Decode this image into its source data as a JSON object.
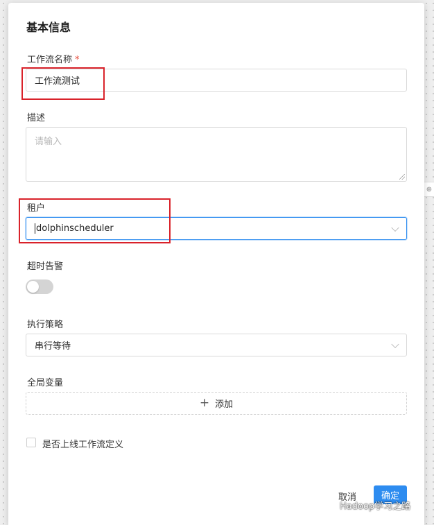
{
  "dialog": {
    "title": "基本信息",
    "fields": {
      "workflow_name": {
        "label": "工作流名称",
        "required_mark": "*",
        "value": "工作流测试"
      },
      "description": {
        "label": "描述",
        "placeholder": "请输入"
      },
      "tenant": {
        "label": "租户",
        "value": "dolphinscheduler"
      },
      "timeout_alarm": {
        "label": "超时告警",
        "enabled": false
      },
      "execution_policy": {
        "label": "执行策略",
        "value": "串行等待"
      },
      "global_variables": {
        "label": "全局变量",
        "add_label": "添加"
      },
      "online_after_save": {
        "label": "是否上线工作流定义",
        "checked": false
      }
    },
    "buttons": {
      "cancel": "取消",
      "confirm": "确定"
    }
  },
  "side_button": "⊕",
  "watermark": "Hadoop学习之路",
  "colors": {
    "primary": "#2d8cf0",
    "required": "#e74c3c",
    "highlight": "#d9222a"
  }
}
